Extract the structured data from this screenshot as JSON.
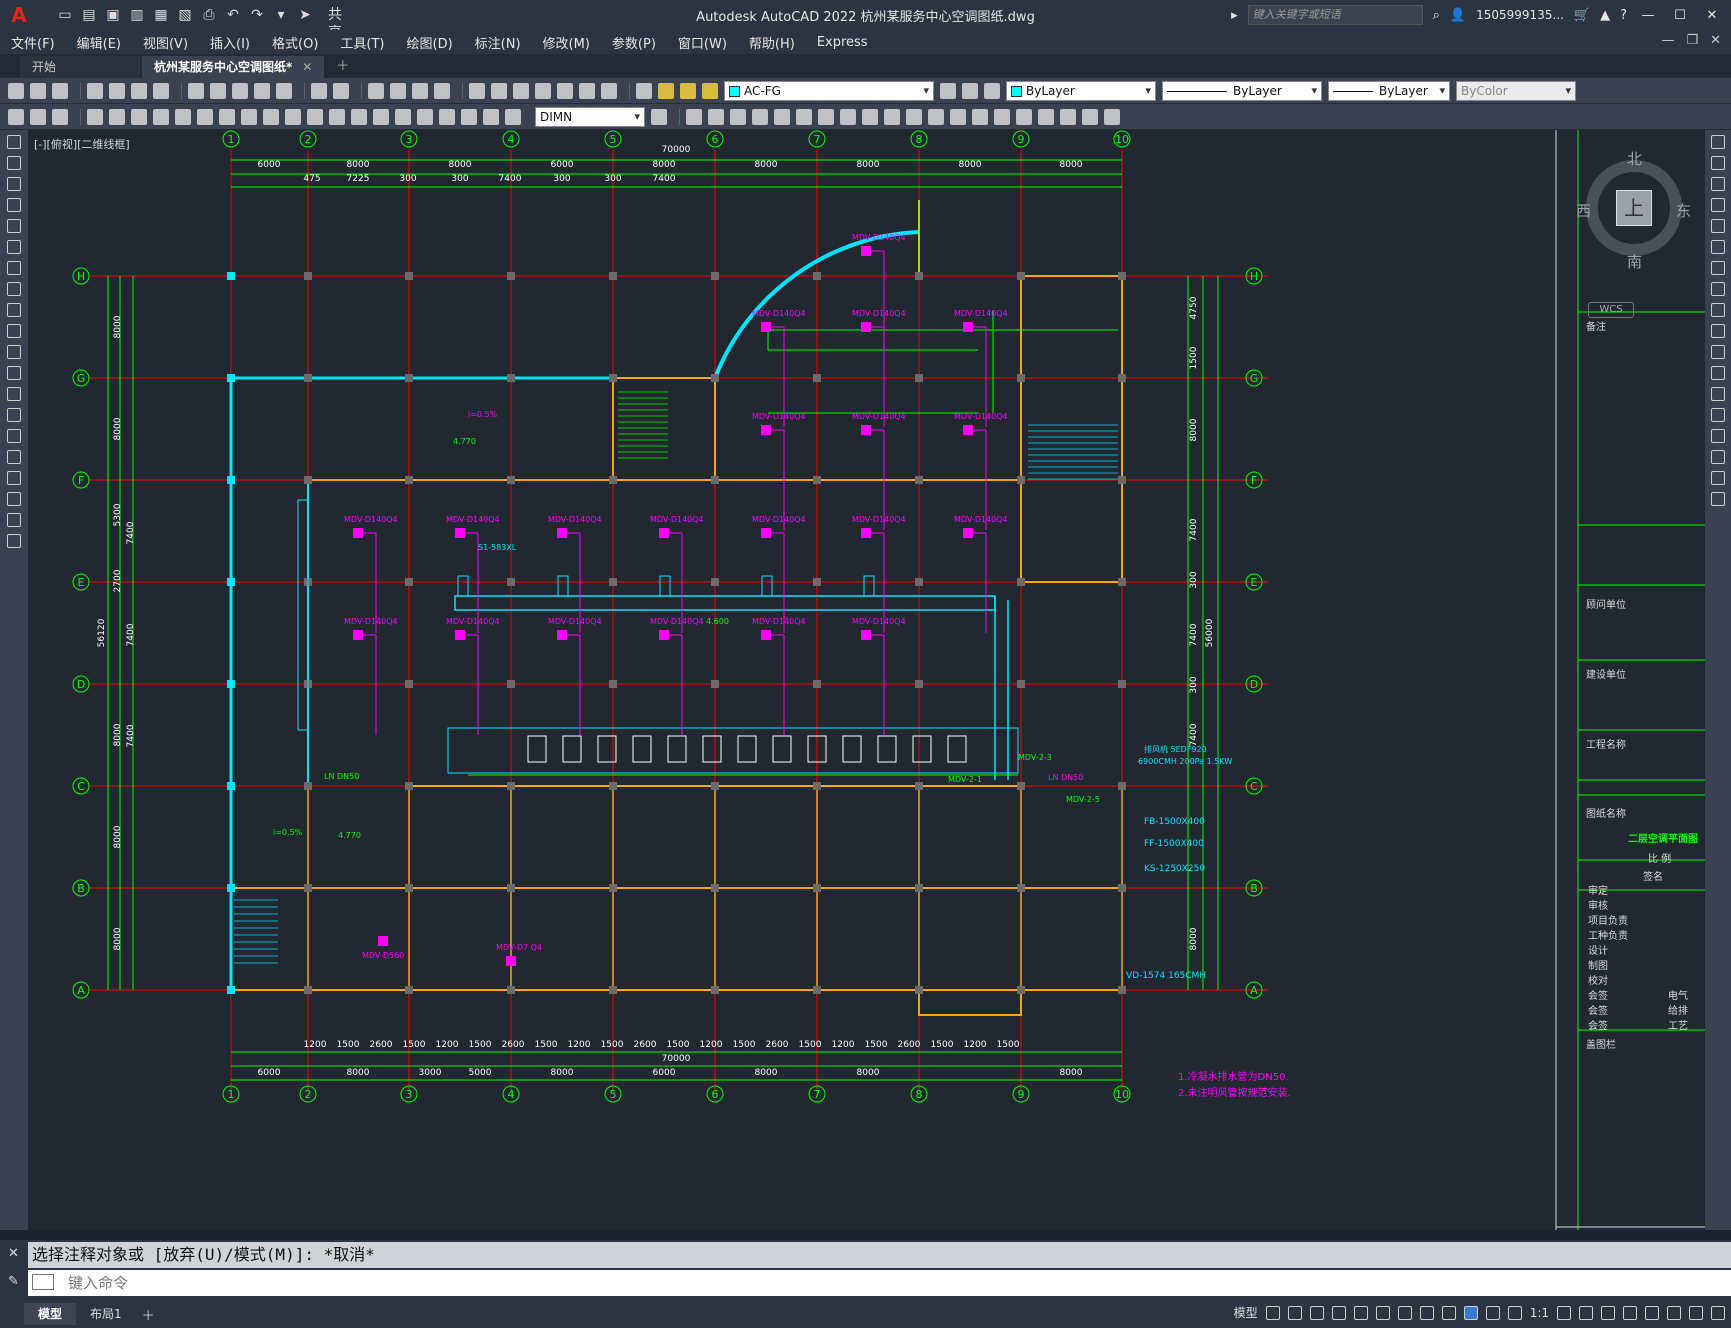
{
  "app": {
    "logo": "A",
    "title": "Autodesk AutoCAD 2022  杭州某服务中心空调图纸.dwg",
    "share": "共享",
    "search_placeholder": "键入关键字或短语",
    "user": "1505999135...",
    "help": "?"
  },
  "menu": [
    "文件(F)",
    "编辑(E)",
    "视图(V)",
    "插入(I)",
    "格式(O)",
    "工具(T)",
    "绘图(D)",
    "标注(N)",
    "修改(M)",
    "参数(P)",
    "窗口(W)",
    "帮助(H)",
    "Express"
  ],
  "tabs": [
    {
      "label": "开始"
    },
    {
      "label": "杭州某服务中心空调图纸*"
    }
  ],
  "layers": {
    "layer": "AC-FG",
    "color": "ByLayer",
    "linetype": "ByLayer",
    "lineweight": "ByLayer",
    "plotstyle": "ByColor",
    "dimstyle": "DIMN",
    "layer_color_hex": "#00ffff"
  },
  "canvas": {
    "view_label": "[-][俯视][二维线框]",
    "viewcube": {
      "n": "北",
      "s": "南",
      "e": "东",
      "w": "西",
      "face": "上",
      "wcs": "WCS"
    },
    "grid_cols": [
      "1",
      "2",
      "3",
      "4",
      "5",
      "6",
      "7",
      "8",
      "9",
      "10"
    ],
    "grid_rows": [
      "H",
      "G",
      "F",
      "E",
      "D",
      "C",
      "B",
      "A"
    ],
    "top_dims": [
      "6000",
      "8000",
      "8000",
      "6000",
      "8000",
      "8000",
      "8000",
      "8000",
      "8000"
    ],
    "top_sub_dims": [
      "475",
      "7225",
      "300",
      "300",
      "7400",
      "300",
      "300",
      "7400",
      "300"
    ],
    "total_width": "70000",
    "left_dims": [
      "8000",
      "8000",
      "5300",
      "2700",
      "8000",
      "8000",
      "8000"
    ],
    "left_sub": [
      "7400",
      "300",
      "7400",
      "300",
      "7400"
    ],
    "total_height": "56120",
    "right_total": "56000",
    "right_dims": [
      "4750",
      "1500",
      "8000",
      "7400",
      "300",
      "7400",
      "300",
      "7400",
      "8000"
    ],
    "bottom_dims": [
      "6000",
      "8000",
      "3000",
      "5000",
      "8000",
      "6000",
      "8000",
      "8000",
      "8000"
    ],
    "bottom_sub": [
      "1200",
      "1500",
      "2600",
      "1500",
      "1200",
      "1500",
      "2600",
      "1500",
      "1200",
      "1500",
      "2600",
      "1500",
      "1200",
      "1500",
      "2600",
      "1500",
      "1200",
      "1500",
      "2600",
      "1500",
      "1200",
      "1500",
      "2600",
      "1500"
    ],
    "bottom_total": "70000",
    "units": [
      "MDV-D140Q4",
      "MDV-D140Q4",
      "MDV-D140Q4",
      "MDV-D140Q4",
      "MDV-D140Q4",
      "MDV-D140Q4",
      "MDV-D140Q4",
      "MDV-D140Q4",
      "MDV-D140Q4",
      "MDV-D140Q4",
      "MDV-D140Q4",
      "MDV-D140Q4",
      "MDV-D140Q4",
      "MDV-D140Q4",
      "MDV-D140Q4",
      "MDV-D140Q4",
      "MDV-D140Q4",
      "MDV-D140Q4",
      "MDV-D140Q4",
      "MDV-D140Q4"
    ],
    "annotations": {
      "slope1": "i=0.5%",
      "elev1": "4.770",
      "slope2": "i=0.5%",
      "elev2": "4.770",
      "ln1": "LN DN50",
      "ln2": "LN DN50",
      "fan1": "排风机 5EDF920",
      "fan2": "6900CMH 200Pa 1.5KW",
      "fb": "FB-1500X400",
      "ff": "FF-1500X400",
      "ks": "KS-1250X250",
      "vd": "VD-1574 165CMH",
      "note1": "1.冷凝水排水管为DN50.",
      "note2": "2.未注明风管按规范安装.",
      "mdv_bottom": "MDV-D7 Q4",
      "mdv_bottom2": "MDV-D560",
      "elev3": "4.600",
      "code1": "S1-583XL",
      "mdv_r": "MDV-2-3",
      "mdv_r2": "MDV-2-1",
      "mdv_r3": "MDV-2-5"
    },
    "titleblock": {
      "remark": "备注",
      "consult": "顾问单位",
      "builder": "建设单位",
      "project": "工程名称",
      "drawing": "图纸名称",
      "drawing_name": "二层空调平面图",
      "scale": "比 例",
      "signature": "签名",
      "roles": [
        "审定",
        "审核",
        "项目负责",
        "工种负责",
        "设计",
        "制图",
        "校对",
        "会签",
        "会签",
        "会签"
      ],
      "trades": [
        "电气",
        "给排",
        "工艺"
      ],
      "stamp": "盖图栏"
    }
  },
  "command": {
    "history": "选择注释对象或 [放弃(U)/模式(M)]: *取消*",
    "placeholder": "键入命令"
  },
  "status": {
    "tabs": [
      "模型",
      "布局1"
    ],
    "model_label": "模型",
    "scale": "1:1"
  },
  "colors": {
    "grid_axis": "#ff0000",
    "dim": "#00ff00",
    "wall": "#ffa500",
    "duct": "#00e5ff",
    "unit": "#ff00ff",
    "pipe": "#00ff00"
  }
}
